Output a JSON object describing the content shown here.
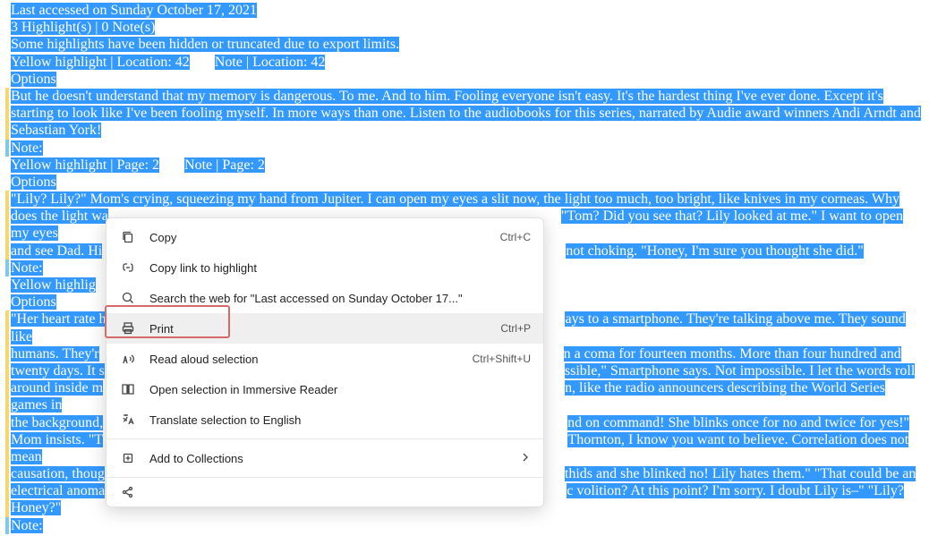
{
  "header": {
    "last_accessed": "Last accessed on Sunday October 17, 2021",
    "counts": "3 Highlight(s) |  0 Note(s)",
    "warning": "Some highlights have been hidden or truncated due to export limits."
  },
  "h1": {
    "tag1": "Yellow highlight | Location: 42",
    "tag2": "Note | Location: 42",
    "options": "Options",
    "body": "But he doesn't understand that my memory is dangerous. To me. And to him. Fooling everyone isn't easy. It's the hardest thing I've ever done. Except it's starting to look like I've been fooling myself. In more ways than one. Listen to the audiobooks for this series, narrated by Audie award winners Andi Arndt and Sebastian York!",
    "note": "Note:"
  },
  "h2": {
    "tag1": "Yellow highlight | Page: 2",
    "tag2": "Note | Page: 2",
    "options": "Options",
    "body_l1": "\"Lily? Lily?\" Mom's crying, squeezing my hand from Jupiter. I can open my eyes a slit now, the light too much, too bright, like knives in my corneas. Why",
    "body_l2a": "does the light wa",
    "body_l2b": "\"Tom? Did you see that? Lily looked at me.\" I want to open my eyes",
    "body_l3a": "and see Dad. Hi",
    "body_l3b": "not choking. \"Honey, I'm sure you thought she did.\"",
    "note": "Note:"
  },
  "h3": {
    "tag1": "Yellow highlig",
    "options": "Options",
    "body_l1a": "\"Her heart rate h",
    "body_l1b": "ays to a smartphone. They're talking above me. They sound like",
    "body_l2a": "humans. They'r",
    "body_l2b": "n a coma for fourteen months. More than four hundred and",
    "body_l3a": "twenty days. It s",
    "body_l3b": "ssible,\" Smartphone says. Not impossible. I let the words roll",
    "body_l4a": "around inside m",
    "body_l4b": "n, like the radio announcers describing the World Series games in",
    "body_l5a": "the background,",
    "body_l5b": "nd on command! She blinks once for no and twice for yes!\"",
    "body_l6a": "Mom insists. \"T",
    "body_l6b": "Thornton, I know you want to believe. Correlation does not mean",
    "body_l7a": "causation, thoug",
    "body_l7b": "thids and she blinked no! Lily hates them.\" \"That could be an",
    "body_l8a": "electrical anoma",
    "body_l8b": "c volition? At this point? I'm sorry. I doubt Lily is–\" \"Lily?",
    "body_l9": "Honey?\"",
    "note": "Note:"
  },
  "menu": {
    "copy": "Copy",
    "copy_short": "Ctrl+C",
    "copy_link": "Copy link to highlight",
    "search": "Search the web for \"Last accessed on Sunday October 17...\"",
    "print": "Print",
    "print_short": "Ctrl+P",
    "read_aloud": "Read aloud selection",
    "read_aloud_short": "Ctrl+Shift+U",
    "immersive": "Open selection in Immersive Reader",
    "translate": "Translate selection to English",
    "collections": "Add to Collections"
  }
}
